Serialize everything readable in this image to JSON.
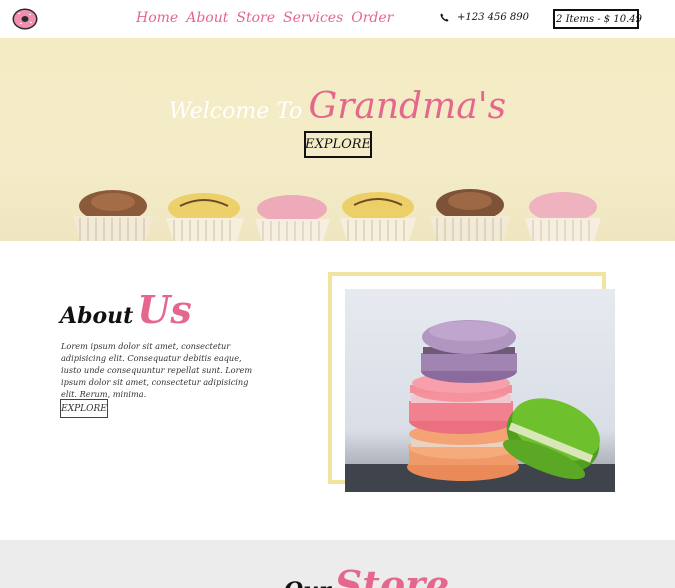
{
  "nav": {
    "links": [
      "Home",
      "About",
      "Store",
      "Services",
      "Order"
    ],
    "phone": "+123 456 890",
    "cart": "2 Items - $ 10.49"
  },
  "hero": {
    "welcome": "Welcome To",
    "brand": "Grandma's",
    "button": "EXPLORE"
  },
  "about": {
    "title_a": "About",
    "title_b": "Us",
    "text": "Lorem ipsum dolor sit amet, consectetur adipisicing elit. Consequatur debitis eaque, iusto unde consequuntur repellat sunt. Lorem ipsum dolor sit amet, consectetur adipisicing elit. Rerum, minima.",
    "button": "EXPLORE"
  },
  "store": {
    "title_a": "Our",
    "title_b": "Store"
  },
  "colors": {
    "accent": "#e4678d",
    "frame": "#f1e49f",
    "hero_bg": "#f3ebc3",
    "store_bg": "#ececec"
  },
  "icons": [
    "donut-logo-icon",
    "phone-icon",
    "cart-icon"
  ]
}
